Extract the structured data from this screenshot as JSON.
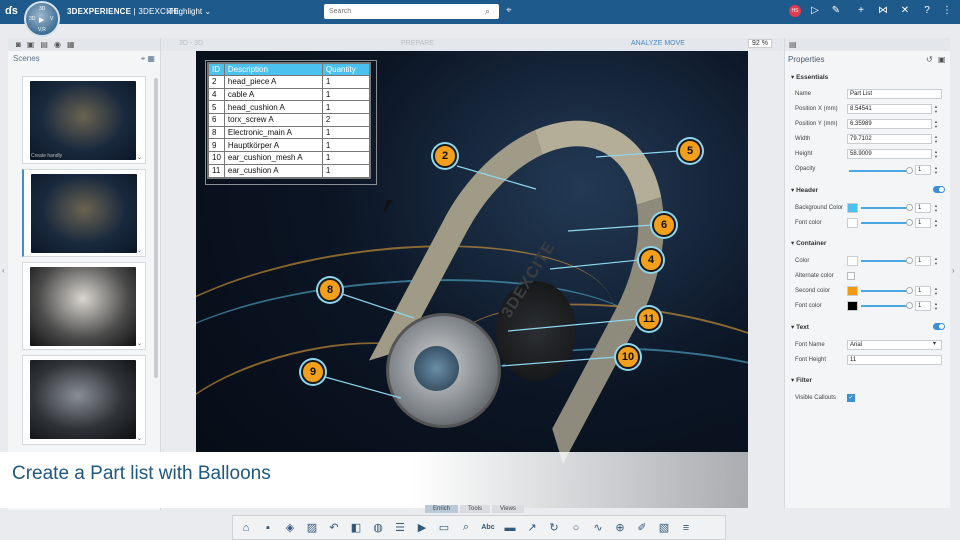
{
  "header": {
    "brand_bold": "3DEXPERIENCE",
    "brand_rest": " | 3DEXCITE",
    "app_name": "xHighlight ⌄",
    "search_placeholder": "Search",
    "avatar_initials": "HS"
  },
  "compass": {
    "top": "3D",
    "left": "3D",
    "right": "V",
    "bottom": "V,R"
  },
  "scenes": {
    "title": "Scenes",
    "thumb_label": "Create handly"
  },
  "viewport": {
    "mode_left": "3D - 3D",
    "mode_center": "PREPARE",
    "mode_right": "ANALYZE   MOVE",
    "zoom": "92 %"
  },
  "part_table": {
    "headers": [
      "ID",
      "Description",
      "Quantity"
    ],
    "rows": [
      [
        "2",
        "head_piece A",
        "1"
      ],
      [
        "4",
        "cable A",
        "1"
      ],
      [
        "5",
        "head_cushion A",
        "1"
      ],
      [
        "6",
        "torx_screw A",
        "2"
      ],
      [
        "8",
        "Electronic_main A",
        "1"
      ],
      [
        "9",
        "Hauptkörper A",
        "1"
      ],
      [
        "10",
        "ear_cushion_mesh A",
        "1"
      ],
      [
        "11",
        "ear_cushion A",
        "1"
      ]
    ]
  },
  "balloons": [
    "2",
    "5",
    "6",
    "4",
    "8",
    "11",
    "10",
    "9"
  ],
  "product_logo": "3DEXCITE",
  "banner": "Create a Part list with Balloons",
  "bottom_tabs": [
    "Enrich",
    "Tools",
    "Views"
  ],
  "properties": {
    "title": "Properties",
    "essentials": "Essentials",
    "name_label": "Name",
    "name_value": "Part List",
    "posx_label": "Position X (mm)",
    "posx_value": "8.54541",
    "posy_label": "Position Y (mm)",
    "posy_value": "6.35989",
    "width_label": "Width",
    "width_value": "79.7102",
    "height_label": "Height",
    "height_value": "58.9009",
    "opacity_label": "Opacity",
    "opacity_value": "1",
    "header_section": "Header",
    "bg_label": "Background Color",
    "bg_value": "1",
    "font_color_label": "Font color",
    "font_color_value": "1",
    "container_section": "Container",
    "color_label": "Color",
    "color_value": "1",
    "alt_color_label": "Alternate color",
    "second_color_label": "Second color",
    "second_color_value": "1",
    "cont_font_label": "Font color",
    "cont_font_value": "1",
    "text_section": "Text",
    "font_name_label": "Font Name",
    "font_name_value": "Arial",
    "font_height_label": "Font Height",
    "font_height_value": "11",
    "filter_section": "Filter",
    "visible_callouts_label": "Visible Callouts"
  },
  "colors": {
    "topbar": "#1f5a8c",
    "table_header": "#4bc1f0",
    "balloon": "#f2a01c",
    "header_bg": "#4bc1f0",
    "second_color": "#f29a0e",
    "accent": "#3b8fd5"
  }
}
